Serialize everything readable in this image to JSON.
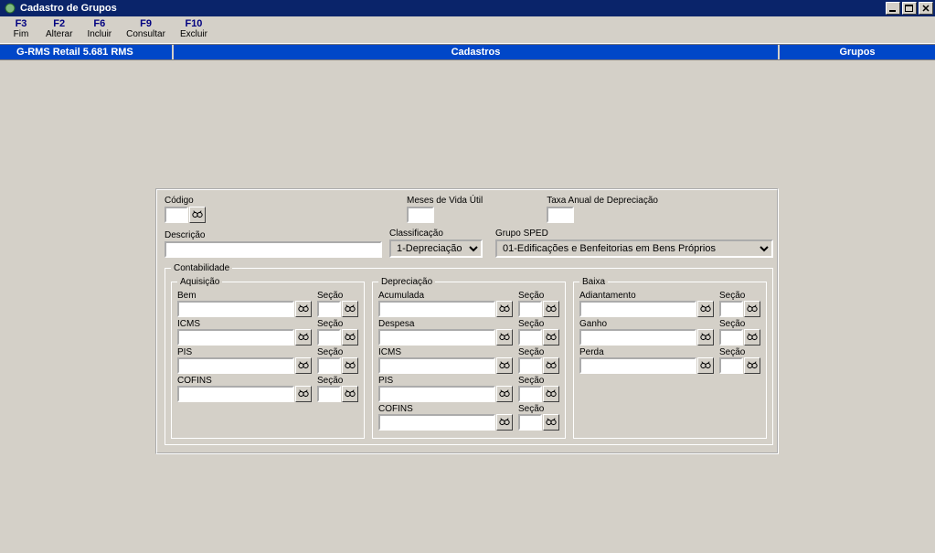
{
  "window": {
    "title": "Cadastro de Grupos"
  },
  "menu": [
    {
      "key": "F3",
      "label": "Fim"
    },
    {
      "key": "F2",
      "label": "Alterar"
    },
    {
      "key": "F6",
      "label": "Incluir"
    },
    {
      "key": "F9",
      "label": "Consultar"
    },
    {
      "key": "F10",
      "label": "Excluir"
    }
  ],
  "breadcrumb": {
    "left": "G-RMS Retail 5.681 RMS",
    "center": "Cadastros",
    "right": "Grupos"
  },
  "form": {
    "codigo": {
      "label": "Código",
      "value": ""
    },
    "meses": {
      "label": "Meses de Vida Útil",
      "value": ""
    },
    "taxa": {
      "label": "Taxa Anual de Depreciação",
      "value": ""
    },
    "descricao": {
      "label": "Descrição",
      "value": ""
    },
    "classificacao": {
      "label": "Classificação",
      "value": "1-Depreciação"
    },
    "gruposped": {
      "label": "Grupo SPED",
      "value": "01-Edificações e Benfeitorias em Bens Próprios"
    }
  },
  "contabilidade": {
    "legend": "Contabilidade",
    "secao_label": "Seção",
    "aquisicao": {
      "legend": "Aquisição",
      "rows": [
        {
          "label": "Bem",
          "v": "",
          "s": ""
        },
        {
          "label": "ICMS",
          "v": "",
          "s": ""
        },
        {
          "label": "PIS",
          "v": "",
          "s": ""
        },
        {
          "label": "COFINS",
          "v": "",
          "s": ""
        }
      ]
    },
    "depreciacao": {
      "legend": "Depreciação",
      "rows": [
        {
          "label": "Acumulada",
          "v": "",
          "s": ""
        },
        {
          "label": "Despesa",
          "v": "",
          "s": ""
        },
        {
          "label": "ICMS",
          "v": "",
          "s": ""
        },
        {
          "label": "PIS",
          "v": "",
          "s": ""
        },
        {
          "label": "COFINS",
          "v": "",
          "s": ""
        }
      ]
    },
    "baixa": {
      "legend": "Baixa",
      "rows": [
        {
          "label": "Adiantamento",
          "v": "",
          "s": ""
        },
        {
          "label": "Ganho",
          "v": "",
          "s": ""
        },
        {
          "label": "Perda",
          "v": "",
          "s": ""
        }
      ]
    }
  }
}
